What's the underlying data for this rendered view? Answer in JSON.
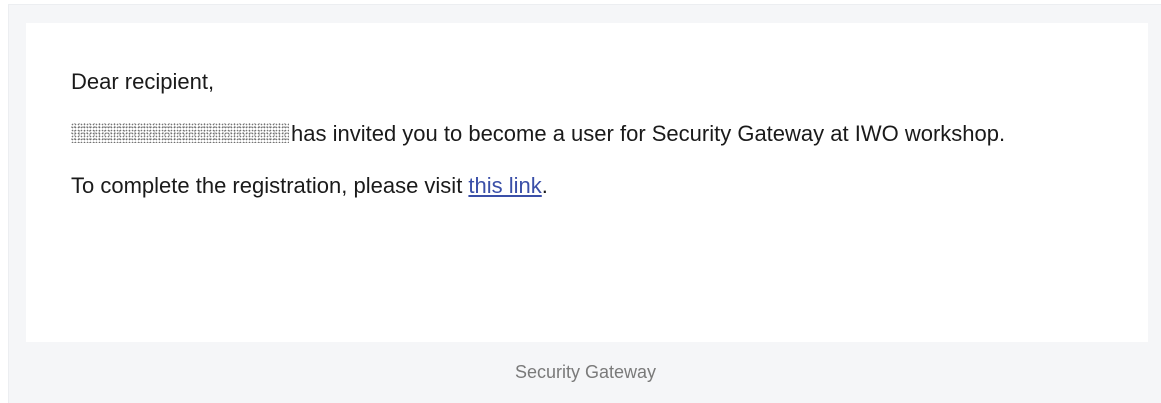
{
  "email": {
    "greeting": "Dear recipient,",
    "invite_text": "has invited you to become a user for Security Gateway at IWO workshop.",
    "registration_prefix": "To complete the registration, please visit ",
    "registration_link": "this link",
    "registration_suffix": "."
  },
  "footer": {
    "text": "Security Gateway"
  },
  "colors": {
    "page_background": "#f5f6f8",
    "card_background": "#ffffff",
    "link": "#3a4fa8",
    "footer_text": "#7a7a7a"
  }
}
